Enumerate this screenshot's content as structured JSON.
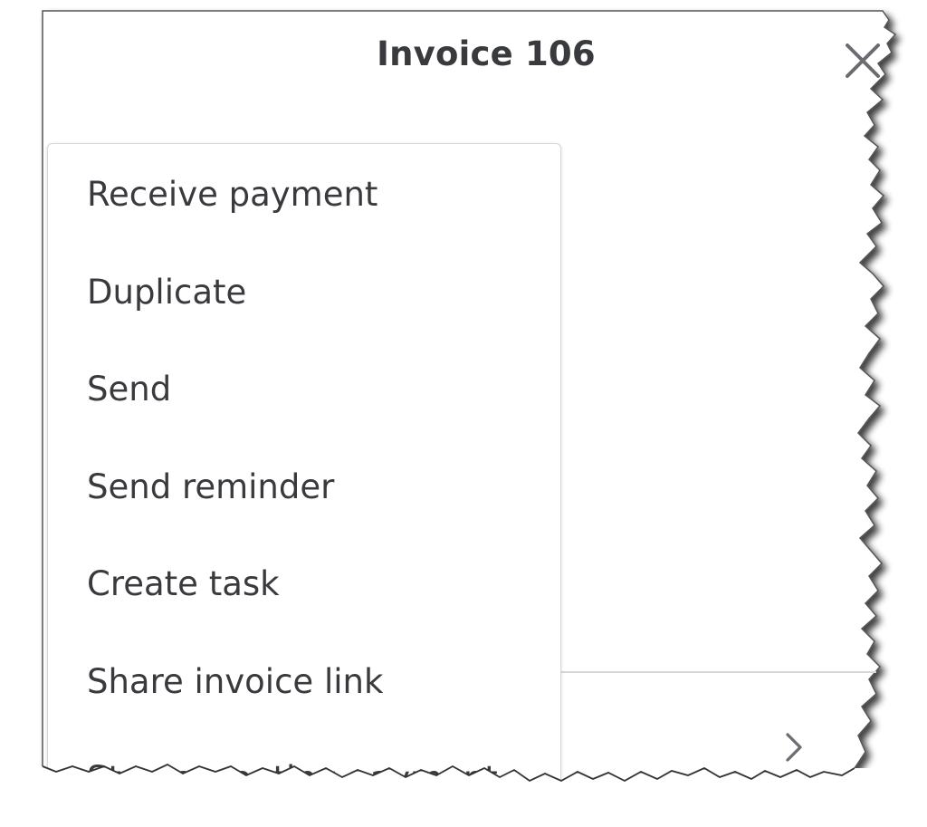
{
  "dialog": {
    "title": "Invoice 106",
    "close_icon": "close-icon",
    "chevron_icon": "chevron-right-icon"
  },
  "menu": {
    "items": [
      {
        "label": "Receive payment"
      },
      {
        "label": "Duplicate"
      },
      {
        "label": "Send"
      },
      {
        "label": "Send reminder"
      },
      {
        "label": "Create task"
      },
      {
        "label": "Share invoice link"
      },
      {
        "label": "Stop accepting payment"
      }
    ]
  },
  "colors": {
    "text": "#393a3d",
    "border": "#d4d7dc"
  }
}
